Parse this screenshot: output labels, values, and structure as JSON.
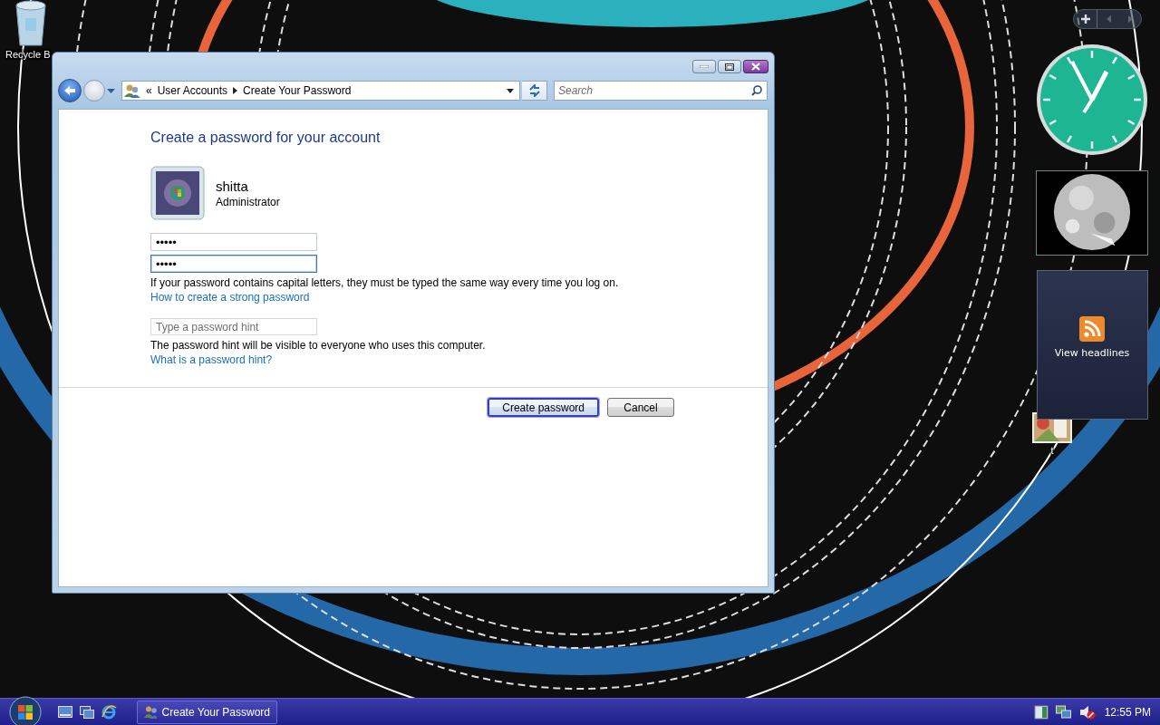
{
  "desktop": {
    "icons": [
      {
        "label": "Recycle B",
        "kind": "recycle-bin"
      },
      {
        "label": "t"
      }
    ]
  },
  "window": {
    "address": {
      "overflow": "«",
      "crumbs": [
        "User Accounts",
        "Create Your Password"
      ]
    },
    "search": {
      "placeholder": "Search"
    },
    "heading": "Create a password for your account",
    "user": {
      "name": "shitta",
      "role": "Administrator"
    },
    "password_fields": [
      {
        "value": "•••••",
        "focused": false
      },
      {
        "value": "•••••",
        "focused": true
      }
    ],
    "capitals_note": "If your password contains capital letters, they must be typed the same way every time you log on.",
    "strong_password_link": "How to create a strong password",
    "hint_field": {
      "placeholder": "Type a password hint"
    },
    "hint_note": "The password hint will be visible to everyone who uses this computer.",
    "hint_link": "What is a password hint?",
    "buttons": [
      {
        "label": "Create password",
        "default": true
      },
      {
        "label": "Cancel",
        "default": false
      }
    ]
  },
  "gadgets": {
    "feed": {
      "label": "View headlines"
    }
  },
  "taskbar": {
    "tasks": [
      {
        "label": "Create Your Password",
        "selected": true
      }
    ],
    "clock": "12:55 PM"
  }
}
